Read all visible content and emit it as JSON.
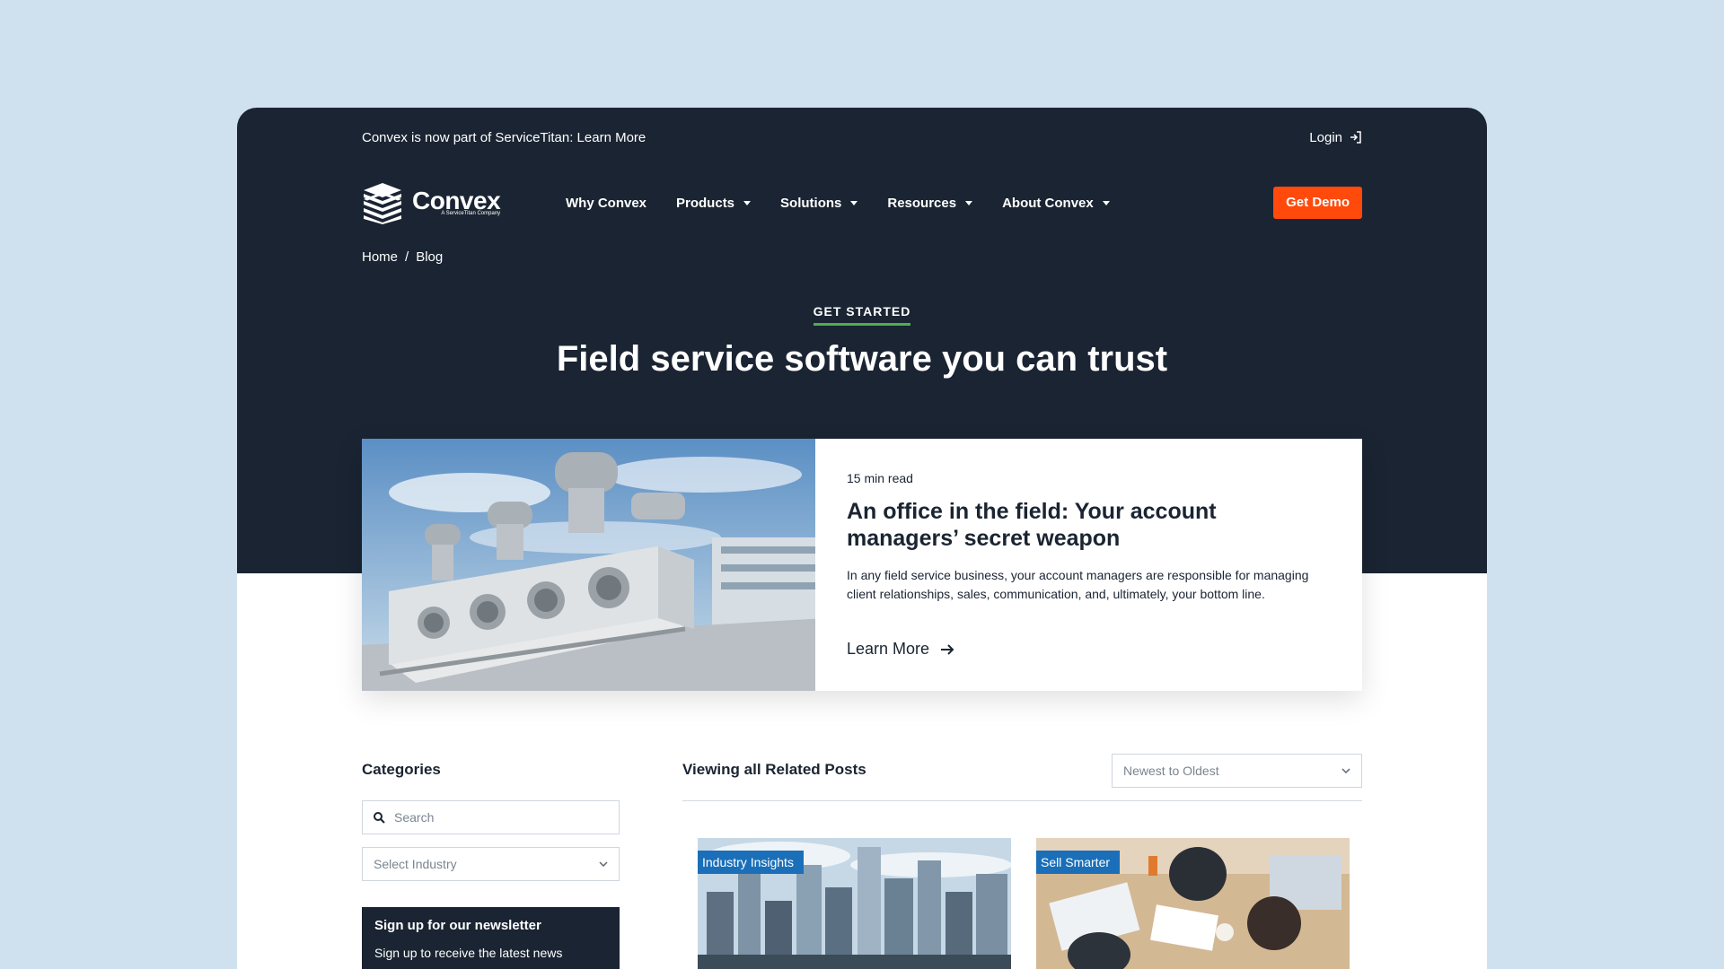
{
  "announcement": "Convex is now part of ServiceTitan: Learn More",
  "login": "Login",
  "logo": {
    "name": "Convex",
    "tagline": "A ServiceTitan Company"
  },
  "nav": {
    "why": "Why Convex",
    "products": "Products",
    "solutions": "Solutions",
    "resources": "Resources",
    "about": "About Convex"
  },
  "cta": "Get Demo",
  "breadcrumb": {
    "home": "Home",
    "sep": "/",
    "current": "Blog"
  },
  "hero": {
    "eyebrow": "GET STARTED",
    "title": "Field service software you can trust"
  },
  "featured": {
    "read_time": "15 min read",
    "title": "An office in the field: Your account managers’ secret weapon",
    "description": "In any field service business, your account managers are responsible for managing client relationships, sales, communication, and, ultimately, your bottom line.",
    "link": "Learn More"
  },
  "sidebar": {
    "title": "Categories",
    "search_placeholder": "Search",
    "industry_select": "Select Industry",
    "newsletter_title": "Sign up for our newsletter",
    "newsletter_desc": "Sign up to receive the latest news"
  },
  "posts": {
    "title": "Viewing all Related Posts",
    "sort": "Newest to Oldest",
    "cards": [
      {
        "badge": "Industry Insights"
      },
      {
        "badge": "Sell Smarter"
      }
    ]
  },
  "colors": {
    "navy": "#1a2432",
    "accent_orange": "#ff4a0c",
    "badge_blue": "#1a6fb8",
    "eyebrow_green": "#4caf50",
    "page_bg": "#cfe1ee"
  }
}
